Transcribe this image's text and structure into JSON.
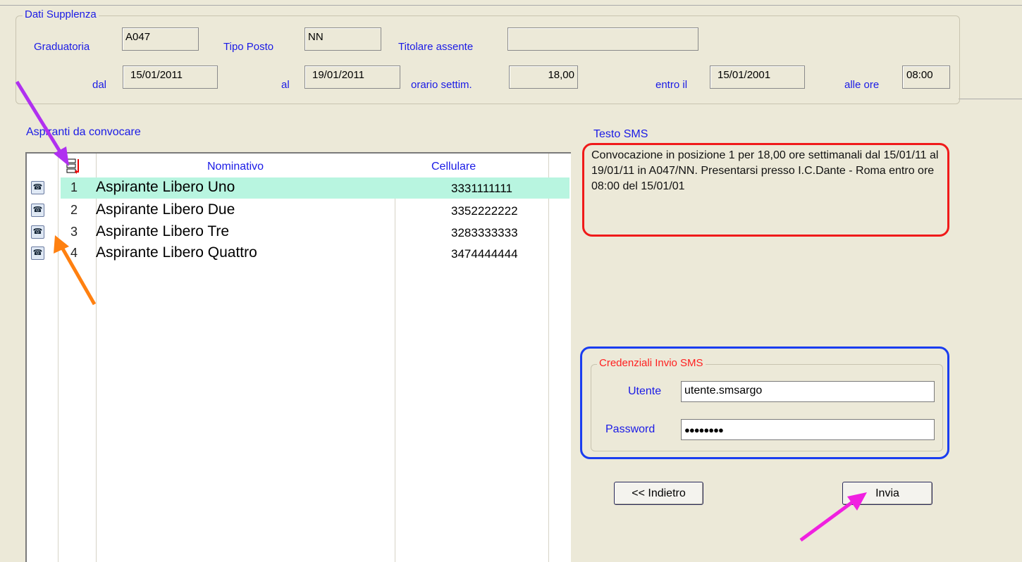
{
  "dati_supplenza": {
    "legend": "Dati Supplenza",
    "graduatoria_label": "Graduatoria",
    "graduatoria_value": "A047",
    "tipo_posto_label": "Tipo Posto",
    "tipo_posto_value": "NN",
    "titolare_label": "Titolare assente",
    "titolare_value": "",
    "dal_label": "dal",
    "dal_value": "15/01/2011",
    "al_label": "al",
    "al_value": "19/01/2011",
    "orario_label": "orario settim.",
    "orario_value": "18,00",
    "entro_label": "entro il",
    "entro_value": "15/01/2001",
    "alle_ore_label": "alle ore",
    "alle_ore_value": "08:00"
  },
  "aspiranti": {
    "title": "Aspiranti da convocare",
    "columns": {
      "nominativo": "Nominativo",
      "cellulare": "Cellulare"
    },
    "rows": [
      {
        "num": "1",
        "nome": "Aspirante Libero Uno",
        "cell": "3331111111"
      },
      {
        "num": "2",
        "nome": "Aspirante Libero Due",
        "cell": "3352222222"
      },
      {
        "num": "3",
        "nome": "Aspirante Libero Tre",
        "cell": "3283333333"
      },
      {
        "num": "4",
        "nome": "Aspirante Libero Quattro",
        "cell": "3474444444"
      }
    ]
  },
  "sms": {
    "title": "Testo SMS",
    "text": "Convocazione in posizione 1 per 18,00 ore settimanali dal 15/01/11 al 19/01/11 in A047/NN. Presentarsi presso I.C.Dante - Roma entro ore 08:00 del 15/01/01"
  },
  "credenziali": {
    "legend": "Credenziali Invio SMS",
    "utente_label": "Utente",
    "utente_value": "utente.smsargo",
    "password_label": "Password",
    "password_value": "●●●●●●●●"
  },
  "buttons": {
    "indietro": "<< Indietro",
    "invia": "Invia"
  },
  "colors": {
    "label_blue": "#1a1ae6",
    "legend_red": "#ff2020",
    "annotation_purple": "#b030f0",
    "annotation_orange": "#ff8010",
    "annotation_magenta": "#f020e0",
    "highlight_row": "#b8f5e0"
  }
}
